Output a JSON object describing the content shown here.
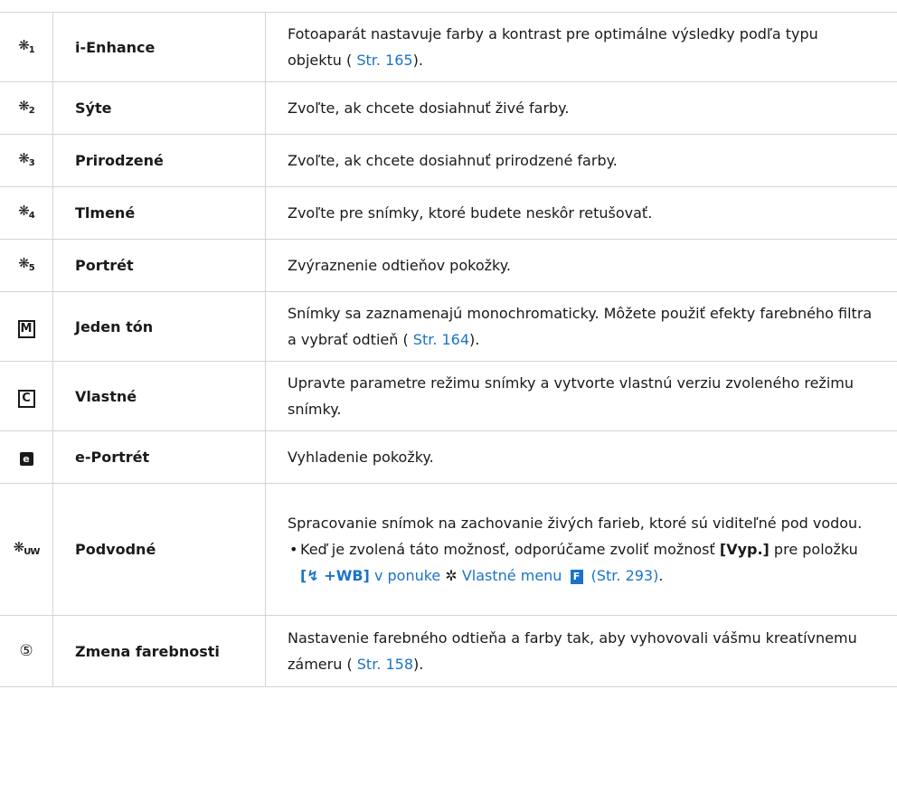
{
  "rows": [
    {
      "icon": "art-1-icon",
      "icon_text": "1",
      "name": "i-Enhance",
      "desc_pre": "Fotoaparát nastavuje farby a kontrast pre optimálne výsledky podľa typu objektu (",
      "link": " Str. 165",
      "desc_post": ")."
    },
    {
      "icon": "art-2-icon",
      "icon_text": "2",
      "name": "Sýte",
      "desc": "Zvoľte, ak chcete dosiahnuť živé farby."
    },
    {
      "icon": "art-3-icon",
      "icon_text": "3",
      "name": "Prirodzené",
      "desc": "Zvoľte, ak chcete dosiahnuť prirodzené farby."
    },
    {
      "icon": "art-4-icon",
      "icon_text": "4",
      "name": "Tlmené",
      "desc": "Zvoľte pre snímky, ktoré budete neskôr retušovať."
    },
    {
      "icon": "art-5-icon",
      "icon_text": "5",
      "name": "Portrét",
      "desc": "Zvýraznenie odtieňov pokožky."
    },
    {
      "icon": "monotone-icon",
      "icon_text": "M",
      "name": "Jeden tón",
      "desc_pre": "Snímky sa zaznamenajú monochromaticky. Môžete použiť efekty farebného filtra a vybrať odtieň (",
      "link": " Str. 164",
      "desc_post": ")."
    },
    {
      "icon": "custom-icon",
      "icon_text": "C",
      "name": "Vlastné",
      "desc": "Upravte parametre režimu snímky a vytvorte vlastnú verziu zvoleného režimu snímky."
    },
    {
      "icon": "e-portrait-icon",
      "icon_text": "e",
      "name": "e-Portrét",
      "desc": "Vyhladenie pokožky."
    },
    {
      "icon": "underwater-icon",
      "icon_text": "UW",
      "name": "Podvodné",
      "desc": "Spracovanie snímok na zachovanie živých farieb, ktoré sú viditeľné pod vodou.",
      "bullet": {
        "pre": "Keď je zvolená táto možnosť, odporúčame zvoliť možnosť ",
        "bold1": "[Vyp.]",
        "mid": " pre položku ",
        "bold2": "[",
        "flash_glyph": "↯",
        "bold3": " +WB]",
        "link1": " v ponuke ",
        "gear_glyph": "✲",
        "link2": " Vlastné menu ",
        "fkey": "F",
        "link3": " (Str. 293)",
        "end": "."
      }
    },
    {
      "icon": "color-creator-icon",
      "icon_text": "⑤",
      "name": "Zmena farebnosti",
      "desc_pre": "Nastavenie farebného odtieňa a farby tak, aby vyhovovali vášmu kreatívnemu zámeru (",
      "link": " Str. 158",
      "desc_post": ")."
    }
  ]
}
